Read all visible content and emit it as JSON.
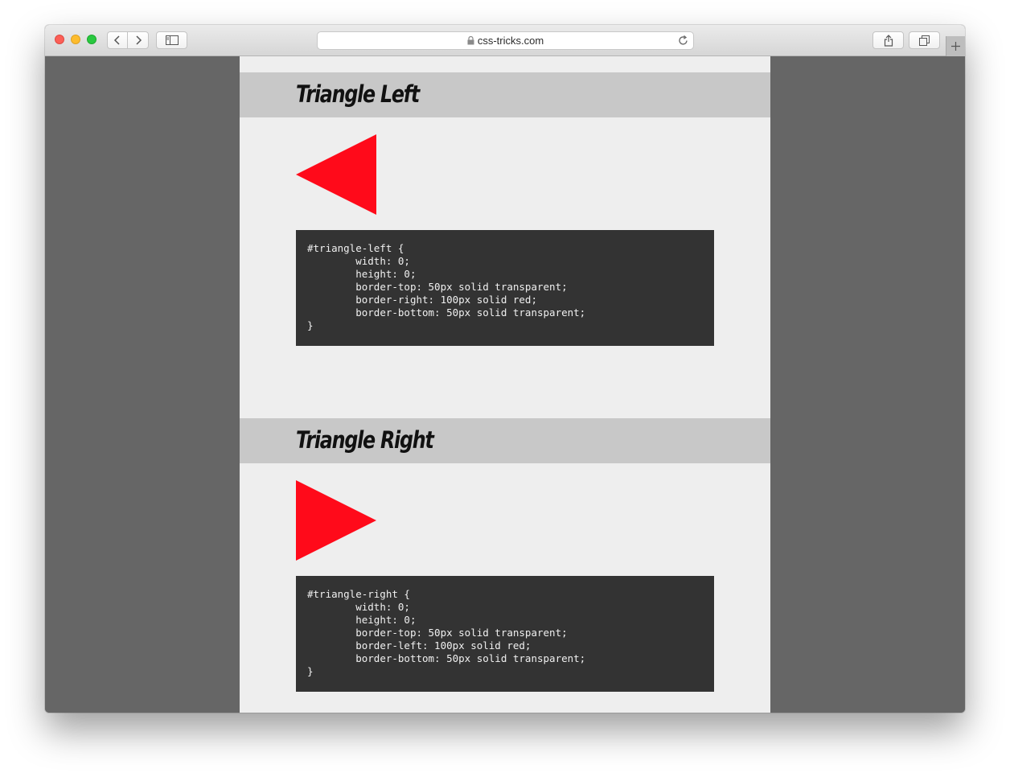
{
  "browser": {
    "url": "css-tricks.com",
    "icons": {
      "back": "chevron-left-icon",
      "forward": "chevron-right-icon",
      "sidebar": "sidebar-icon",
      "lock": "lock-icon",
      "reload": "reload-icon",
      "share": "share-icon",
      "tabs": "tabs-overview-icon",
      "new_tab": "plus-icon"
    }
  },
  "sections": [
    {
      "title": "Triangle Left",
      "triangle_color": "#ff0a1a",
      "direction": "left",
      "code": "#triangle-left {\n\twidth: 0;\n\theight: 0;\n\tborder-top: 50px solid transparent;\n\tborder-right: 100px solid red;\n\tborder-bottom: 50px solid transparent;\n}"
    },
    {
      "title": "Triangle Right",
      "triangle_color": "#ff0a1a",
      "direction": "right",
      "code": "#triangle-right {\n\twidth: 0;\n\theight: 0;\n\tborder-top: 50px solid transparent;\n\tborder-left: 100px solid red;\n\tborder-bottom: 50px solid transparent;\n}"
    }
  ],
  "colors": {
    "page_background": "#eeeeee",
    "heading_band": "#c8c8c8",
    "code_background": "#333333",
    "outer_background": "#666666"
  }
}
